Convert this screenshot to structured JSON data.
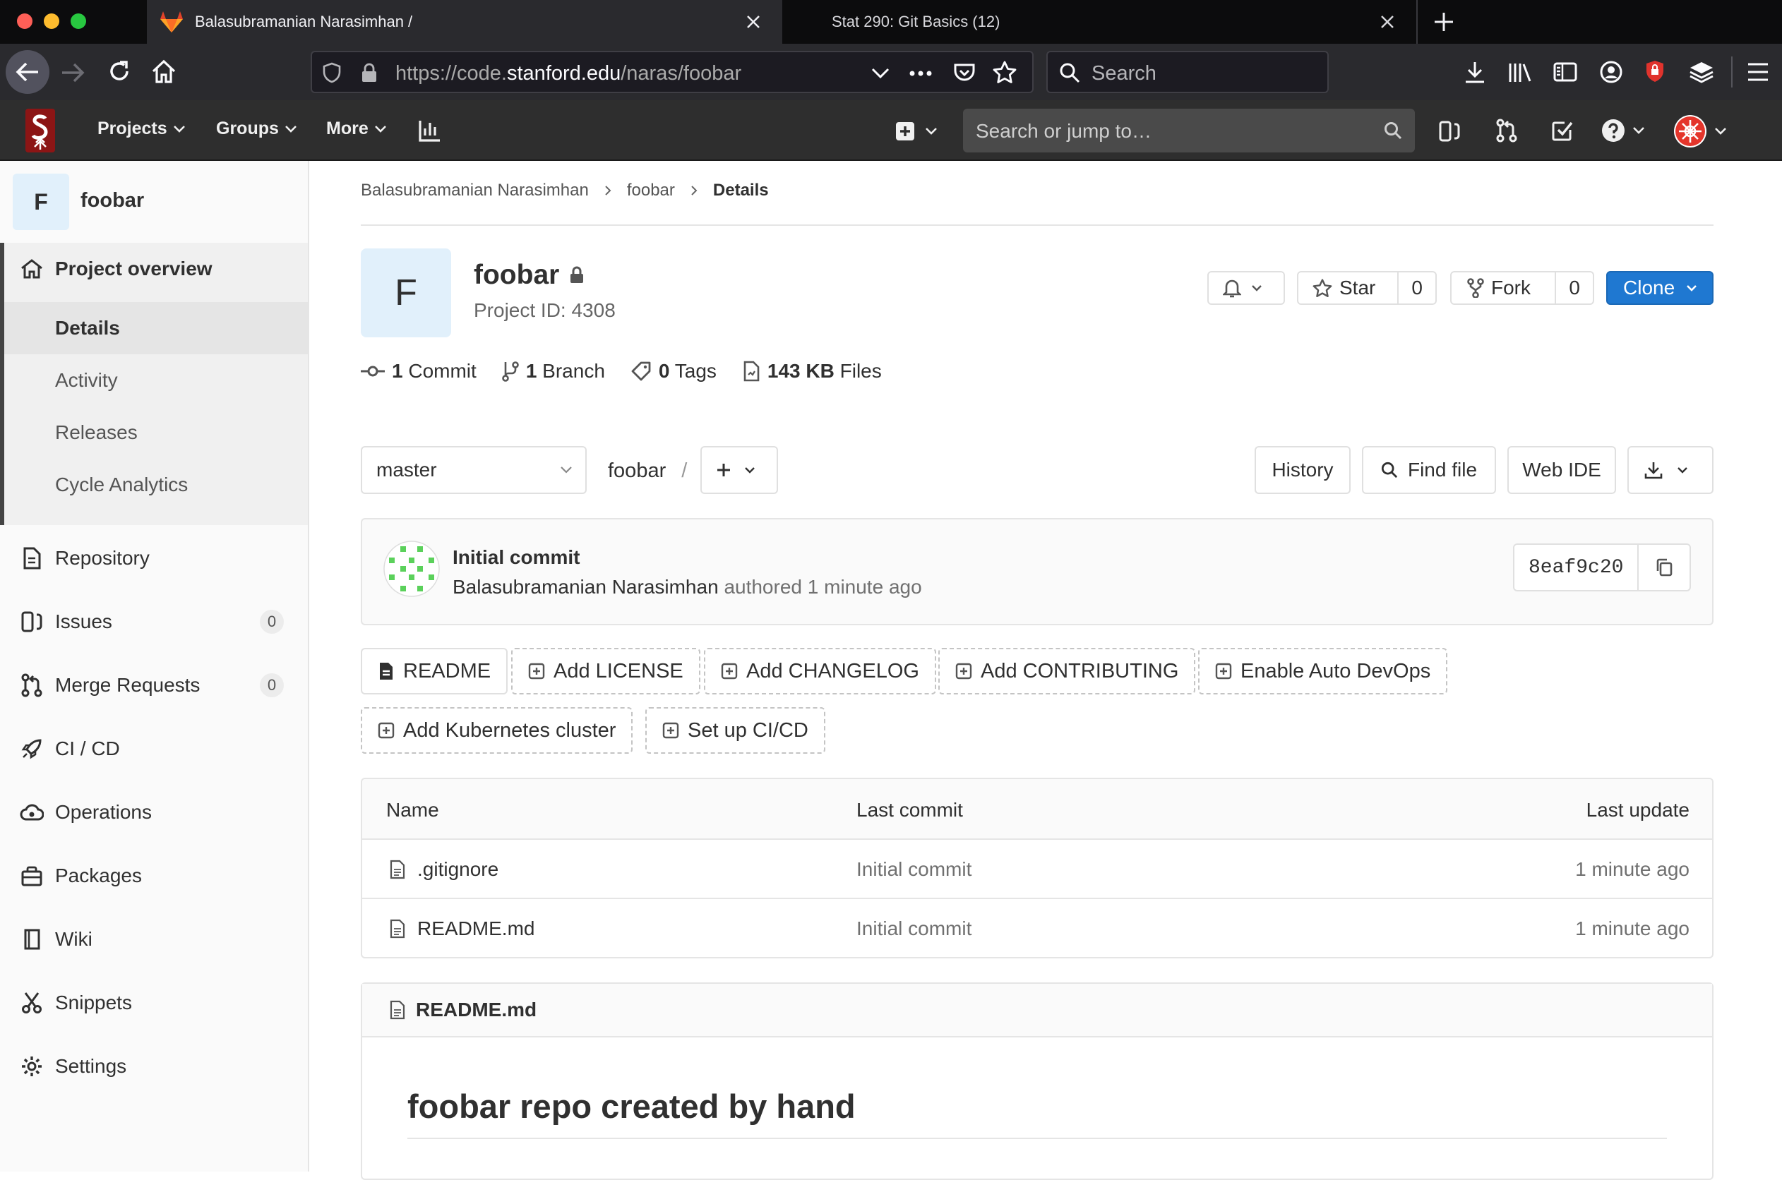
{
  "browser": {
    "tabs": [
      {
        "title": "Balasubramanian Narasimhan / "
      },
      {
        "title": "Stat 290: Git Basics (12)"
      }
    ],
    "url_prefix": "https://code.",
    "url_host": "stanford.edu",
    "url_path": "/naras/foobar",
    "search_placeholder": "Search"
  },
  "gitlab": {
    "nav": {
      "projects": "Projects",
      "groups": "Groups",
      "more": "More"
    },
    "search_placeholder": "Search or jump to…",
    "brand_color": "#8c1515"
  },
  "sidebar": {
    "avatar_letter": "F",
    "project_name": "foobar",
    "overview": "Project overview",
    "overview_items": [
      "Details",
      "Activity",
      "Releases",
      "Cycle Analytics"
    ],
    "items": [
      {
        "label": "Repository",
        "icon": "document-icon"
      },
      {
        "label": "Issues",
        "icon": "issues-icon",
        "badge": "0"
      },
      {
        "label": "Merge Requests",
        "icon": "merge-request-icon",
        "badge": "0"
      },
      {
        "label": "CI / CD",
        "icon": "rocket-icon"
      },
      {
        "label": "Operations",
        "icon": "cloud-gear-icon"
      },
      {
        "label": "Packages",
        "icon": "package-icon"
      },
      {
        "label": "Wiki",
        "icon": "book-icon"
      },
      {
        "label": "Snippets",
        "icon": "scissors-icon"
      },
      {
        "label": "Settings",
        "icon": "gear-icon"
      }
    ]
  },
  "breadcrumb": [
    "Balasubramanian Narasimhan",
    "foobar",
    "Details"
  ],
  "project": {
    "avatar_letter": "F",
    "name": "foobar",
    "id_text": "Project ID: 4308",
    "star_label": "Star",
    "star_count": "0",
    "fork_label": "Fork",
    "fork_count": "0",
    "clone_label": "Clone",
    "stats": {
      "commits_n": "1",
      "commits_l": "Commit",
      "branches_n": "1",
      "branches_l": "Branch",
      "tags_n": "0",
      "tags_l": "Tags",
      "files_n": "143 KB",
      "files_l": "Files"
    }
  },
  "repo_toolbar": {
    "branch": "master",
    "path": "foobar",
    "history": "History",
    "find_file": "Find file",
    "web_ide": "Web IDE"
  },
  "last_commit": {
    "title": "Initial commit",
    "author": "Balasubramanian Narasimhan",
    "authored": "authored",
    "time": "1 minute ago",
    "sha": "8eaf9c20"
  },
  "quick_actions": [
    "README",
    "Add LICENSE",
    "Add CHANGELOG",
    "Add CONTRIBUTING",
    "Enable Auto DevOps",
    "Add Kubernetes cluster",
    "Set up CI/CD"
  ],
  "file_table": {
    "headers": [
      "Name",
      "Last commit",
      "Last update"
    ],
    "rows": [
      {
        "name": ".gitignore",
        "commit": "Initial commit",
        "updated": "1 minute ago"
      },
      {
        "name": "README.md",
        "commit": "Initial commit",
        "updated": "1 minute ago"
      }
    ]
  },
  "readme": {
    "file": "README.md",
    "heading": "foobar repo created by hand"
  },
  "colors": {
    "clone_blue": "#1f78d1",
    "identicon_green": "#5bd15b"
  }
}
